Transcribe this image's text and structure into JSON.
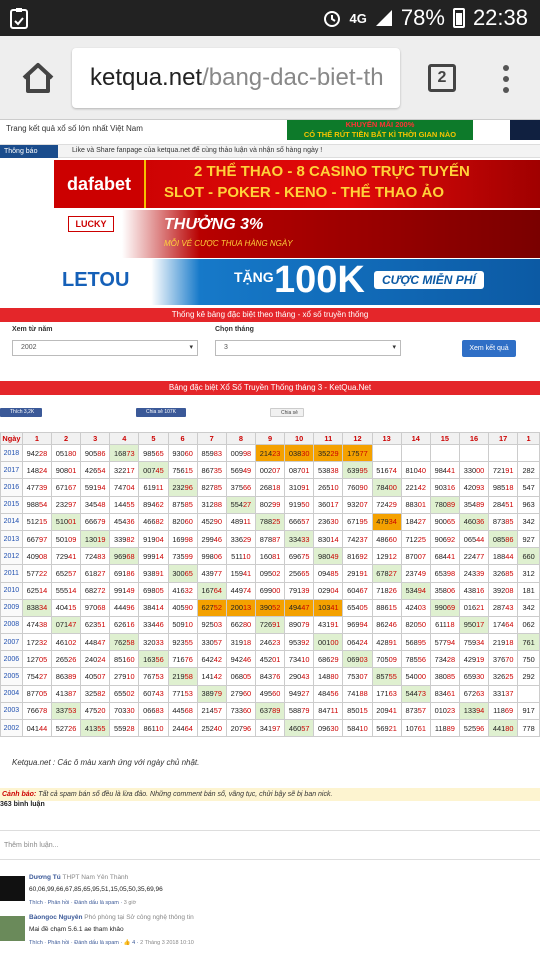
{
  "status_bar": {
    "network": "4G",
    "battery": "78%",
    "time": "22:38"
  },
  "browser": {
    "url_domain": "ketqua.net",
    "url_path": "/bang-dac-biet-th",
    "tab_count": "2"
  },
  "site": {
    "tagline": "Trang kết quả xổ số lớn nhất Việt Nam",
    "top_banner_line1": "KHUYẾN MÃI 200%",
    "top_banner_line2": "CÓ THỂ RÚT TIỀN BẤT KÌ THỜI GIAN NÀO",
    "notice_label": "Thông báo",
    "notice_text": "Like và Share fanpage của ketqua.net để cùng thảo luận và nhận số hàng ngày !"
  },
  "ads": {
    "dafabet": {
      "brand": "dafabet",
      "line1": "2 THỂ THAO - 8 CASINO TRỰC TUYẾN",
      "line2": "SLOT - POKER - KENO - THỂ THAO ẢO"
    },
    "lucky": {
      "brand": "LUCKY",
      "line1": "THƯỞNG 3%",
      "line2": "MỖI VÉ CƯỢC THUA HÀNG NGÀY"
    },
    "letou": {
      "brand": "LETOU",
      "tang": "TẶNG",
      "amount": "100K",
      "tail": "CƯỢC MIỄN PHÍ"
    }
  },
  "filter": {
    "title": "Thống kê bảng đặc biệt theo tháng - xổ số truyền thống",
    "from_year_label": "Xem từ năm",
    "from_year_value": "2002",
    "month_label": "Chọn tháng",
    "month_value": "3",
    "submit_label": "Xem kết quả"
  },
  "table_title": "Bảng đặc biệt Xổ Số Truyền Thống tháng 3 - KetQua.Net",
  "social": {
    "like": "Thích 3,2K",
    "share": "Chia sẻ 107K",
    "gplus": "Chia sẻ"
  },
  "table": {
    "header_first": "Ngày",
    "days": [
      "1",
      "2",
      "3",
      "4",
      "5",
      "6",
      "7",
      "8",
      "9",
      "10",
      "11",
      "12",
      "13",
      "14",
      "15",
      "16",
      "17",
      "1"
    ],
    "rows": [
      {
        "year": "2018",
        "cells": [
          "94228",
          "05180",
          "90586",
          "16873",
          "98565",
          "93060",
          "85983",
          "00998",
          "21423",
          "03830",
          "35229",
          "17577",
          "",
          "",
          "",
          "",
          "",
          ""
        ],
        "hl": {
          "3": "g",
          "8": "o",
          "9": "o",
          "10": "o",
          "11": "o"
        }
      },
      {
        "year": "2017",
        "cells": [
          "14824",
          "90801",
          "42654",
          "32217",
          "00745",
          "75615",
          "86735",
          "56949",
          "00207",
          "08701",
          "53838",
          "63995",
          "51674",
          "81040",
          "98441",
          "33000",
          "72191",
          "282"
        ],
        "hl": {
          "4": "g",
          "11": "g"
        }
      },
      {
        "year": "2016",
        "cells": [
          "47739",
          "67167",
          "59194",
          "74704",
          "61911",
          "23296",
          "82785",
          "37566",
          "26818",
          "31091",
          "26510",
          "76090",
          "78400",
          "22142",
          "90316",
          "42093",
          "98518",
          "547"
        ],
        "hl": {
          "5": "g",
          "12": "g"
        }
      },
      {
        "year": "2015",
        "cells": [
          "98854",
          "23297",
          "34548",
          "14455",
          "89462",
          "87585",
          "31288",
          "55427",
          "80299",
          "91950",
          "36017",
          "93207",
          "72429",
          "88301",
          "78089",
          "35489",
          "28451",
          "963"
        ],
        "hl": {
          "7": "g",
          "14": "g"
        }
      },
      {
        "year": "2014",
        "cells": [
          "51215",
          "51001",
          "66679",
          "45436",
          "46682",
          "82060",
          "45290",
          "48911",
          "78825",
          "66657",
          "23630",
          "67195",
          "47934",
          "18427",
          "90065",
          "46036",
          "87385",
          "342"
        ],
        "hl": {
          "1": "g",
          "8": "g",
          "12": "o",
          "15": "g"
        }
      },
      {
        "year": "2013",
        "cells": [
          "66797",
          "50109",
          "13019",
          "33982",
          "91904",
          "16998",
          "29946",
          "33629",
          "87887",
          "33433",
          "83014",
          "74237",
          "48660",
          "71225",
          "90692",
          "06544",
          "08586",
          "927"
        ],
        "hl": {
          "2": "g",
          "9": "g",
          "16": "g"
        }
      },
      {
        "year": "2012",
        "cells": [
          "40908",
          "72941",
          "72483",
          "96968",
          "99914",
          "73599",
          "99806",
          "51110",
          "16081",
          "69675",
          "98049",
          "81692",
          "12912",
          "87007",
          "68441",
          "22477",
          "18844",
          "660"
        ],
        "hl": {
          "3": "g",
          "10": "g",
          "17": "g"
        }
      },
      {
        "year": "2011",
        "cells": [
          "57722",
          "65257",
          "61827",
          "69186",
          "93891",
          "30065",
          "43977",
          "15941",
          "09502",
          "25665",
          "09485",
          "29191",
          "67827",
          "23749",
          "65398",
          "24339",
          "32685",
          "312"
        ],
        "hl": {
          "5": "g",
          "12": "g"
        }
      },
      {
        "year": "2010",
        "cells": [
          "62514",
          "55514",
          "68272",
          "99149",
          "69805",
          "41632",
          "16764",
          "44974",
          "69900",
          "79139",
          "02904",
          "60467",
          "71826",
          "53494",
          "35806",
          "43816",
          "39208",
          "181"
        ],
        "hl": {
          "6": "g",
          "13": "g"
        }
      },
      {
        "year": "2009",
        "cells": [
          "83834",
          "40415",
          "97068",
          "44496",
          "38414",
          "40590",
          "62752",
          "20013",
          "39052",
          "49447",
          "10341",
          "65405",
          "88615",
          "42403",
          "99069",
          "01621",
          "28743",
          "342"
        ],
        "hl": {
          "0": "g",
          "6": "o",
          "7": "o",
          "8": "o",
          "9": "o",
          "10": "o",
          "14": "g"
        }
      },
      {
        "year": "2008",
        "cells": [
          "47438",
          "07147",
          "62351",
          "62616",
          "33446",
          "50910",
          "92503",
          "66280",
          "72691",
          "89079",
          "43191",
          "96994",
          "86246",
          "82050",
          "61118",
          "95017",
          "17464",
          "062"
        ],
        "hl": {
          "1": "g",
          "8": "g",
          "15": "g"
        }
      },
      {
        "year": "2007",
        "cells": [
          "17232",
          "46102",
          "44847",
          "76258",
          "32033",
          "92355",
          "33057",
          "31918",
          "24623",
          "95392",
          "00100",
          "06424",
          "42891",
          "56895",
          "57794",
          "75934",
          "21918",
          "761"
        ],
        "hl": {
          "3": "g",
          "10": "g",
          "17": "g"
        }
      },
      {
        "year": "2006",
        "cells": [
          "12705",
          "26526",
          "24024",
          "85160",
          "16356",
          "71676",
          "64242",
          "94246",
          "45201",
          "73410",
          "68629",
          "06903",
          "70509",
          "78556",
          "73428",
          "42919",
          "37670",
          "750"
        ],
        "hl": {
          "4": "g",
          "11": "g"
        }
      },
      {
        "year": "2005",
        "cells": [
          "75427",
          "86389",
          "40507",
          "27910",
          "76753",
          "21958",
          "14142",
          "06805",
          "84376",
          "29043",
          "14880",
          "75307",
          "85755",
          "54000",
          "38085",
          "65930",
          "32625",
          "292"
        ],
        "hl": {
          "5": "g",
          "12": "g"
        }
      },
      {
        "year": "2004",
        "cells": [
          "87705",
          "41387",
          "32582",
          "65502",
          "60743",
          "77153",
          "38979",
          "27960",
          "49560",
          "94927",
          "48456",
          "74188",
          "17163",
          "54473",
          "83461",
          "67263",
          "33137",
          ""
        ],
        "hl": {
          "6": "g",
          "13": "g"
        }
      },
      {
        "year": "2003",
        "cells": [
          "76678",
          "33753",
          "47520",
          "70330",
          "06683",
          "44568",
          "21457",
          "73360",
          "63789",
          "58879",
          "84711",
          "85015",
          "20941",
          "87357",
          "01023",
          "13394",
          "11869",
          "917"
        ],
        "hl": {
          "1": "g",
          "8": "g",
          "15": "g"
        }
      },
      {
        "year": "2002",
        "cells": [
          "04144",
          "52726",
          "41355",
          "55928",
          "86110",
          "24464",
          "25240",
          "20796",
          "34197",
          "46057",
          "09630",
          "58410",
          "56921",
          "10761",
          "11889",
          "52596",
          "44180",
          "778"
        ],
        "hl": {
          "2": "g",
          "9": "g",
          "16": "g"
        }
      }
    ]
  },
  "note": "Ketqua.net : Các ô màu xanh ứng với ngày chủ nhật.",
  "warning": {
    "label": "Cảnh báo:",
    "text": "Tất cả spam bán số đều là lừa đảo. Những comment bán số, vãng tục, chửi bậy sẽ bị ban nick."
  },
  "comments_count": "363 bình luận",
  "comment_placeholder": "Thêm bình luận...",
  "comments": [
    {
      "name": "Dương Tú",
      "meta": "THPT Nam Yên Thành",
      "body": "60,06,99,66,67,85,65,95,51,15,05,50,35,69,96",
      "actions": "Thích · Phản hồi · Đánh dấu là spam ·",
      "time": "3 giờ"
    },
    {
      "name": "Bàongoc Nguyên",
      "meta": "Phó phòng tại Sở công nghệ thông tin",
      "body": "Mai đề chạm 5.6.1 ae tham khảo",
      "actions": "Thích · Phản hồi · Đánh dấu là spam · 👍 4 ·",
      "time": "2 Tháng 3 2018 10:10"
    }
  ],
  "colors": {
    "red": "#e4262a",
    "green_cell": "#dff0d0",
    "orange_cell": "#f4a100",
    "button_blue": "#2f6fc6"
  }
}
